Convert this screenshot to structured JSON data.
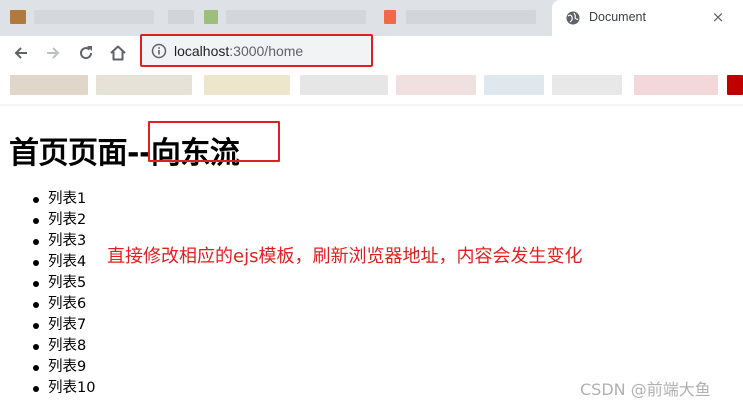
{
  "browser": {
    "tab": {
      "title": "Document",
      "close": "×"
    },
    "address": {
      "host": "localhost",
      "path": ":3000/home"
    }
  },
  "page": {
    "title": "首页页面--向东流",
    "list_items": [
      "列表1",
      "列表2",
      "列表3",
      "列表4",
      "列表5",
      "列表6",
      "列表7",
      "列表8",
      "列表9",
      "列表10"
    ]
  },
  "annotation": {
    "text": "直接修改相应的ejs模板，刷新浏览器地址，内容会发生变化"
  },
  "watermark": {
    "text": "CSDN @前端大鱼"
  },
  "colors": {
    "highlight": "#e02020",
    "tabstrip": "#dee1e6",
    "icon": "#5f6368"
  }
}
